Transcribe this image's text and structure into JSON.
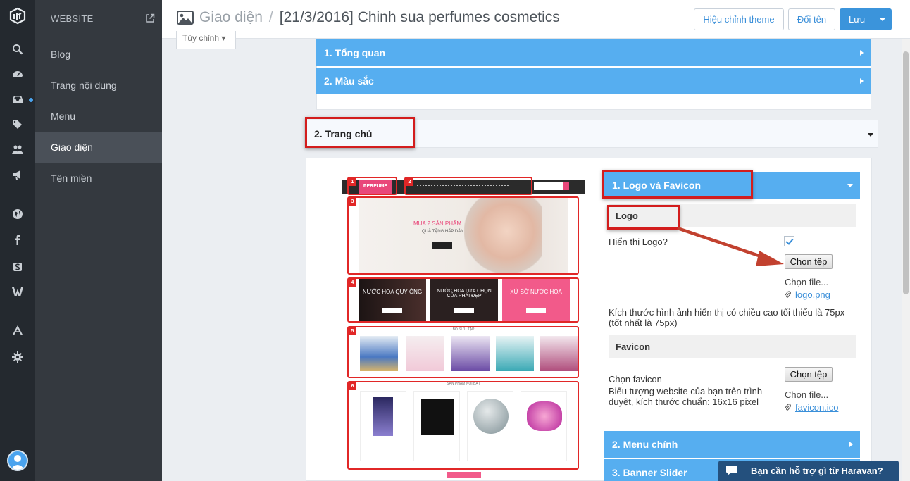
{
  "sidebar": {
    "header": "WEBSITE",
    "items": [
      {
        "label": "Blog"
      },
      {
        "label": "Trang nội dung"
      },
      {
        "label": "Menu"
      },
      {
        "label": "Giao diện"
      },
      {
        "label": "Tên miền"
      }
    ]
  },
  "header": {
    "section": "Giao diện",
    "separator": "/",
    "title": "[21/3/2016] Chinh sua perfumes cosmetics",
    "edit_theme": "Hiệu chỉnh theme",
    "rename": "Đổi tên",
    "save": "Lưu"
  },
  "tuy_chinh": "Tùy chỉnh ▾",
  "top_panels": [
    "1. Tổng quan",
    "2. Màu sắc"
  ],
  "section_home": "2. Trang chủ",
  "preview": {
    "logo_text": "PERFUME",
    "hero_title": "MUA 2 SẢN PHẨM",
    "hero_sub": "QUÀ TẶNG HẤP DẪN",
    "banner1": "NƯỚC HOA QUÝ ÔNG",
    "banner2": "NƯỚC HOA LỰA CHỌN CỦA PHÁI ĐẸP",
    "banner3": "XỨ SỞ NƯỚC HOA",
    "collection_title": "BỘ SƯU TẬP",
    "featured_title": "SẢN PHẨM NỔI BẬT",
    "section_numbers": [
      "1",
      "2",
      "3",
      "4",
      "5",
      "6"
    ]
  },
  "settings": {
    "panel1": "1. Logo và Favicon",
    "logo_header": "Logo",
    "show_logo": "Hiển thị Logo?",
    "show_logo_checked": true,
    "choose_file_btn": "Chọn tệp",
    "choose_file_text": "Chọn file...",
    "logo_file": "logo.png",
    "logo_hint": "Kích thước hình ảnh hiển thị có chiều cao tối thiểu là 75px (tốt nhất là 75px)",
    "favicon_header": "Favicon",
    "favicon_label": "Chọn favicon",
    "favicon_hint": "Biểu tượng website của bạn trên trình duyệt, kích thước chuẩn: 16x16 pixel",
    "favicon_file": "favicon.ico",
    "panel2": "2. Menu chính",
    "panel3": "3. Banner Slider"
  },
  "chat": "Bạn cần hỗ trợ gì từ Haravan?",
  "colors": {
    "accent_blue": "#56aef0",
    "highlight_red": "#d31d1d",
    "rail_bg": "#24292f",
    "sidebar_bg": "#34393f"
  }
}
